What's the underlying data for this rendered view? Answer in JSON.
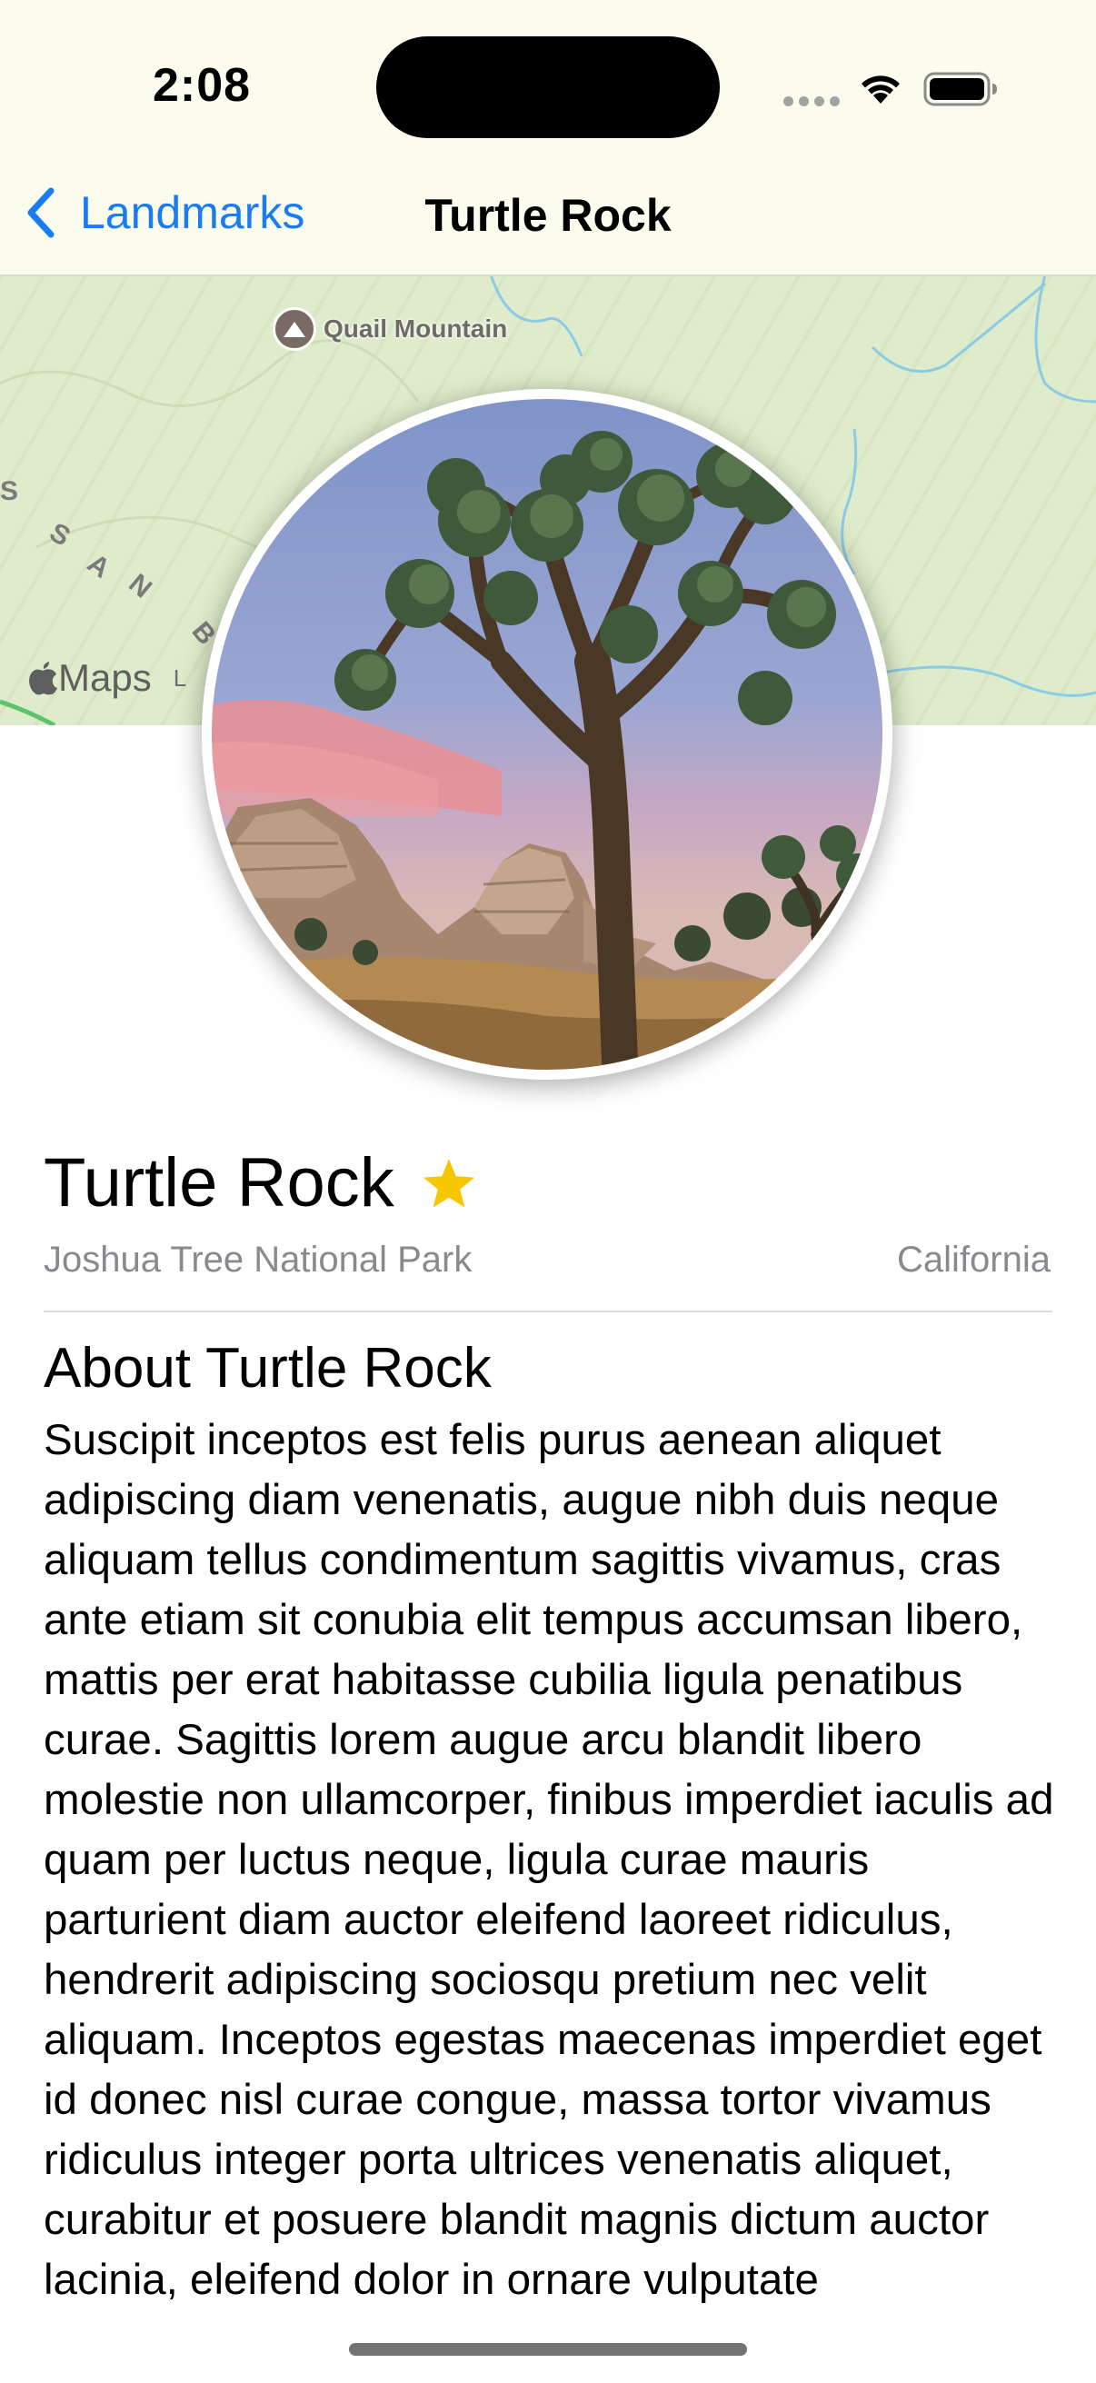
{
  "status_bar": {
    "time": "2:08"
  },
  "nav": {
    "back_label": "Landmarks",
    "title": "Turtle Rock"
  },
  "map": {
    "poi_label": "Quail Mountain",
    "range_letters": [
      "S",
      "A",
      "N",
      "B"
    ],
    "logo_text": "Maps",
    "legal_mark": "L"
  },
  "landmark": {
    "name": "Turtle Rock",
    "is_favorite": true,
    "park": "Joshua Tree National Park",
    "state": "California",
    "about_heading": "About Turtle Rock",
    "description": "Suscipit inceptos est felis purus aenean aliquet adipiscing diam venenatis, augue nibh duis neque aliquam tellus condimentum sagittis vivamus, cras ante etiam sit conubia elit tempus accumsan libero, mattis per erat habitasse cubilia ligula penatibus curae. Sagittis lorem augue arcu blandit libero molestie non ullamcorper, finibus imperdiet iaculis ad quam per luctus neque, ligula curae mauris parturient diam auctor eleifend laoreet ridiculus, hendrerit adipiscing sociosqu pretium nec velit aliquam. Inceptos egestas maecenas imperdiet eget id donec nisl curae congue, massa tortor vivamus ridiculus integer porta ultrices venenatis aliquet, curabitur et posuere blandit magnis dictum auctor lacinia, eleifend dolor in ornare vulputate"
  },
  "colors": {
    "accent": "#1a7cf5",
    "star": "#f7c600",
    "secondary_text": "#8a8a8e",
    "map_land": "#dfeccb",
    "nav_background": "#fbfcee"
  },
  "icons": {
    "back": "chevron-left-icon",
    "favorite": "star-icon",
    "wifi": "wifi-icon",
    "battery": "battery-icon",
    "poi": "mountain-icon",
    "maps_logo": "apple-icon"
  }
}
